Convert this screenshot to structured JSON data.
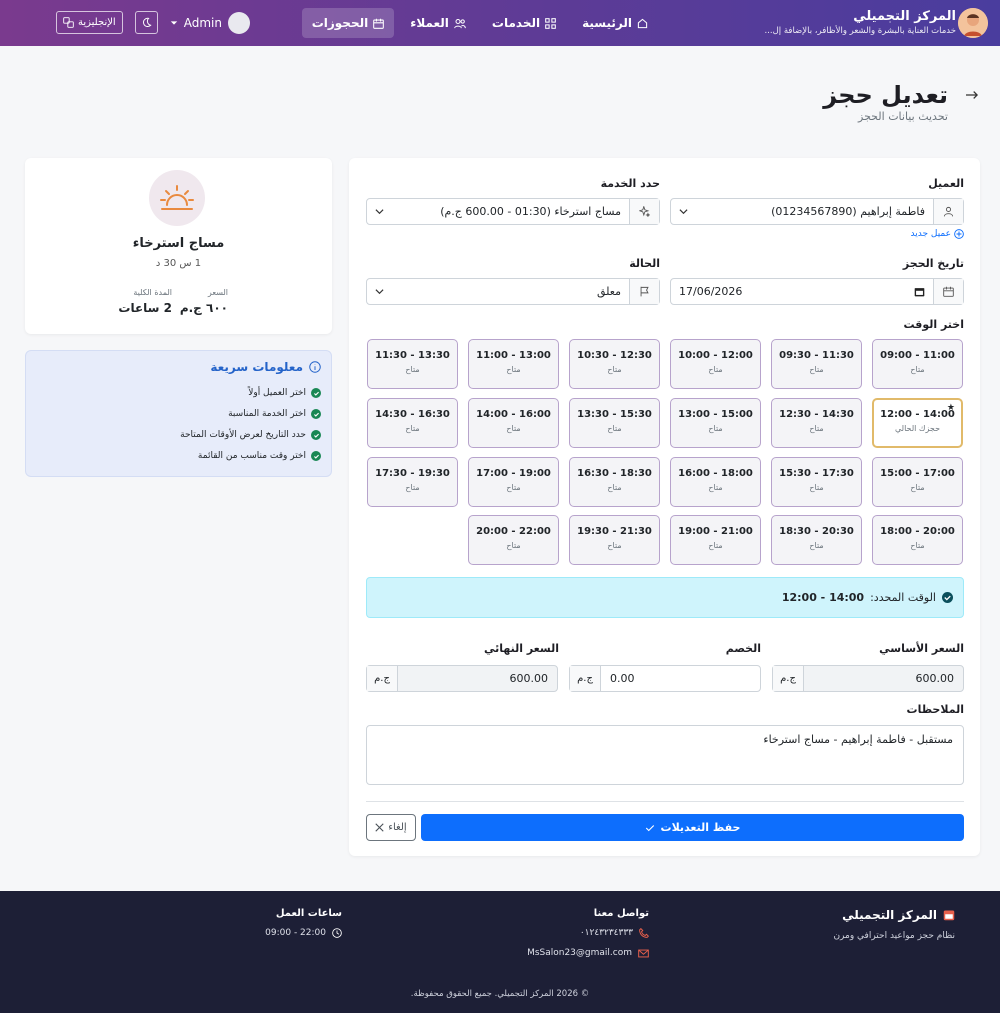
{
  "nav": {
    "brand_title": "المركز التجميلي",
    "brand_sub": "خدمات العناية بالبشرة والشعر والأظافر، بالإضافة إل...",
    "links": [
      "الرئيسية",
      "الخدمات",
      "العملاء",
      "الحجوزات"
    ],
    "active_link": "الحجوزات",
    "user_name": "Admin",
    "lang_label": "الإنجليزية"
  },
  "page": {
    "title": "تعديل حجز",
    "subtitle": "تحديث بيانات الحجز"
  },
  "form": {
    "client_label": "العميل",
    "client_value": "فاطمة إبراهيم (01234567890)",
    "new_client": "عميل جديد",
    "service_label": "حدد الخدمة",
    "service_value": "مساج استرخاء (01:30 - 600.00 ج.م)",
    "date_label": "تاريخ الحجز",
    "date_value": "17/06/2026",
    "status_label": "الحالة",
    "status_value": "معلق",
    "time_label": "اختر الوقت",
    "slots": [
      {
        "time": "09:00 - 11:00",
        "status": "متاح"
      },
      {
        "time": "09:30 - 11:30",
        "status": "متاح"
      },
      {
        "time": "10:00 - 12:00",
        "status": "متاح"
      },
      {
        "time": "10:30 - 12:30",
        "status": "متاح"
      },
      {
        "time": "11:00 - 13:00",
        "status": "متاح"
      },
      {
        "time": "11:30 - 13:30",
        "status": "متاح"
      },
      {
        "time": "12:00 - 14:00",
        "status": "حجزك الحالي",
        "current": true
      },
      {
        "time": "12:30 - 14:30",
        "status": "متاح"
      },
      {
        "time": "13:00 - 15:00",
        "status": "متاح"
      },
      {
        "time": "13:30 - 15:30",
        "status": "متاح"
      },
      {
        "time": "14:00 - 16:00",
        "status": "متاح"
      },
      {
        "time": "14:30 - 16:30",
        "status": "متاح"
      },
      {
        "time": "15:00 - 17:00",
        "status": "متاح"
      },
      {
        "time": "15:30 - 17:30",
        "status": "متاح"
      },
      {
        "time": "16:00 - 18:00",
        "status": "متاح"
      },
      {
        "time": "16:30 - 18:30",
        "status": "متاح"
      },
      {
        "time": "17:00 - 19:00",
        "status": "متاح"
      },
      {
        "time": "17:30 - 19:30",
        "status": "متاح"
      },
      {
        "time": "18:00 - 20:00",
        "status": "متاح"
      },
      {
        "time": "18:30 - 20:30",
        "status": "متاح"
      },
      {
        "time": "19:00 - 21:00",
        "status": "متاح"
      },
      {
        "time": "19:30 - 21:30",
        "status": "متاح"
      },
      {
        "time": "20:00 - 22:00",
        "status": "متاح"
      }
    ],
    "selected_label": "الوقت المحدد:",
    "selected_value": "12:00 - 14:00",
    "base_price_label": "السعر الأساسي",
    "base_price": "600.00",
    "discount_label": "الخصم",
    "discount": "0.00",
    "final_price_label": "السعر النهائي",
    "final_price": "600.00",
    "currency": "ج.م",
    "notes_label": "الملاحظات",
    "notes_value": "مستقبل - فاطمة إبراهيم - مساج استرخاء",
    "save_label": "حفظ التعديلات",
    "cancel_label": "إلغاء"
  },
  "service_card": {
    "name": "مساج استرخاء",
    "duration": "1 س 30 د",
    "price_label": "السعر",
    "price_value": "٦٠٠ ج.م",
    "total_duration_label": "المدة الكلية",
    "total_duration_value": "2 ساعات"
  },
  "quick_info": {
    "title": "معلومات سريعة",
    "items": [
      "اختر العميل أولاً",
      "اختر الخدمة المناسبة",
      "حدد التاريخ لعرض الأوقات المتاحة",
      "اختر وقت مناسب من القائمة"
    ]
  },
  "footer": {
    "brand": "المركز التجميلي",
    "brand_sub": "نظام حجز مواعيد احترافي ومرن",
    "contact_title": "تواصل معنا",
    "phone": "٠١٢٤٣٢٣٤٣٣٣",
    "email": "MsSalon23@gmail.com",
    "hours_title": "ساعات العمل",
    "hours": "09:00 - 22:00",
    "copyright": "© 2026 المركز التجميلي. جميع الحقوق محفوظة."
  },
  "colors": {
    "primary": "#0d6efd",
    "nav_gradient_start": "#7a3a8e",
    "current_slot_border": "#e1ba6a",
    "success": "#198754",
    "footer_bg": "#1d1f36"
  }
}
